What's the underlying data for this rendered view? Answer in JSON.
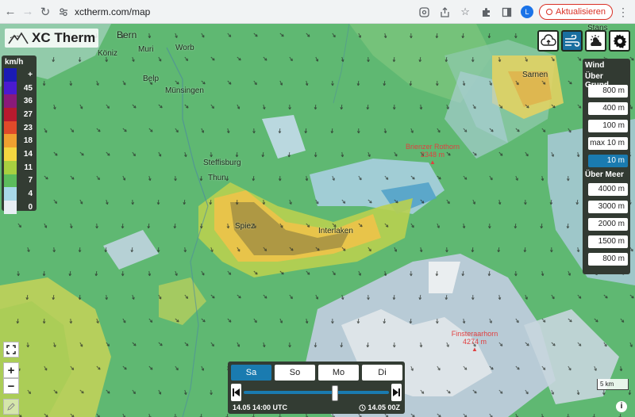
{
  "browser": {
    "url": "xctherm.com/map",
    "update_label": "Aktualisieren",
    "avatar_letter": "L"
  },
  "app": {
    "logo_text": "XC Therm"
  },
  "legend": {
    "unit": "km/h",
    "rows": [
      {
        "label": "+",
        "color": "#1a1ab4"
      },
      {
        "label": "45",
        "color": "#4a1ad0"
      },
      {
        "label": "36",
        "color": "#8a1a7a"
      },
      {
        "label": "27",
        "color": "#b81a2e"
      },
      {
        "label": "23",
        "color": "#e04a2a"
      },
      {
        "label": "18",
        "color": "#f0a030"
      },
      {
        "label": "14",
        "color": "#f4d640"
      },
      {
        "label": "11",
        "color": "#a8d040"
      },
      {
        "label": "7",
        "color": "#5cbc5c"
      },
      {
        "label": "4",
        "color": "#a8d8e8"
      },
      {
        "label": "0",
        "color": "#e8eef4"
      }
    ]
  },
  "wind_panel": {
    "title": "Wind",
    "agl_label": "Über Grund",
    "agl": [
      "800 m",
      "400 m",
      "100 m",
      "max 10 m",
      "10 m"
    ],
    "agl_selected": "10 m",
    "amsl_label": "Über Meer",
    "amsl": [
      "4000 m",
      "3000 m",
      "2000 m",
      "1500 m",
      "800 m"
    ]
  },
  "places": {
    "bern": "Bern",
    "koniz": "Köniz",
    "muri": "Muri",
    "worb": "Worb",
    "belp": "Belp",
    "munsingen": "Münsingen",
    "steffisburg": "Steffisburg",
    "thun": "Thun",
    "spiez": "Spiez",
    "interlaken": "Interlaken",
    "sarnen": "Sarnen",
    "stans": "Stans"
  },
  "peaks": {
    "brienzer_name": "Brienzer Rothorn",
    "brienzer_alt": "2348 m",
    "finsteraar_name": "Finsteraarhorn",
    "finsteraar_alt": "4274 m"
  },
  "timebar": {
    "days": [
      "Sa",
      "So",
      "Mo",
      "Di"
    ],
    "selected_day": "Sa",
    "current_time": "14.05 14:00 UTC",
    "run_label": "14.05 00Z",
    "position": 0.63
  },
  "scale_label": "5 km",
  "info_label": "i",
  "zoom": {
    "in": "+",
    "out": "−"
  }
}
